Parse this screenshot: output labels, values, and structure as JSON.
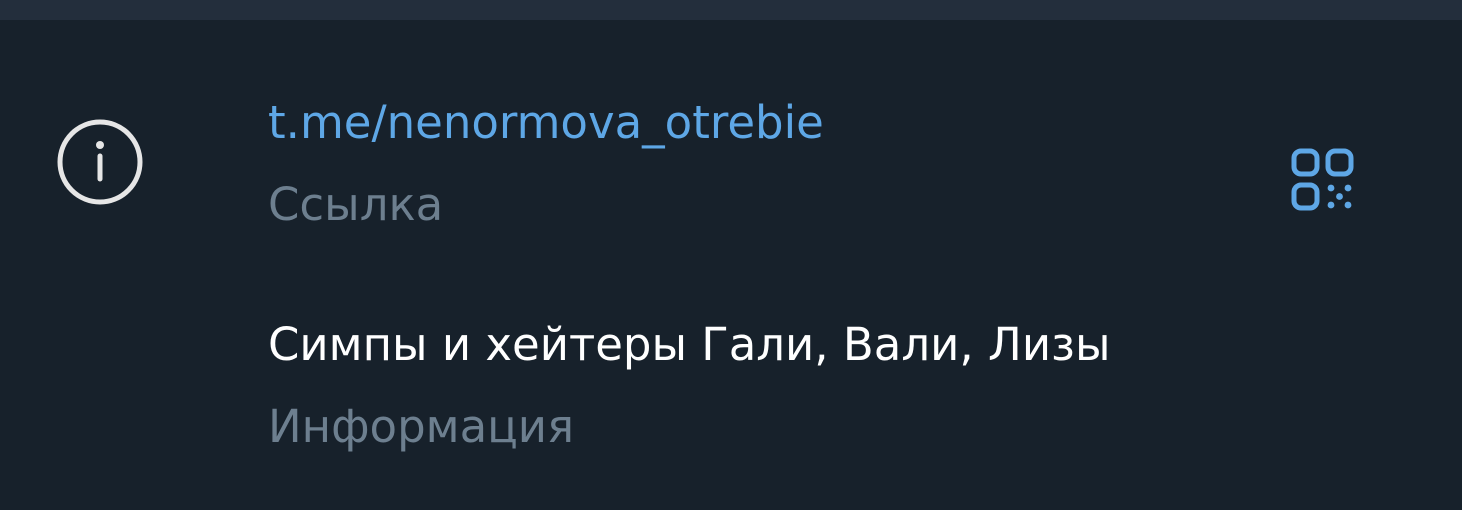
{
  "info": {
    "link": {
      "value": "t.me/nenormova_otrebie",
      "caption": "Ссылка"
    },
    "about": {
      "value": "Симпы и хейтеры Гали, Вали, Лизы",
      "caption": "Информация"
    }
  },
  "icons": {
    "info": "info-circle-icon",
    "qr": "qr-code-icon"
  },
  "colors": {
    "background": "#17212b",
    "divider": "#232e3c",
    "accent": "#5ea7e6",
    "primary_text": "#ffffff",
    "secondary_text": "#6d7f8f",
    "icon": "#e6e6e6"
  }
}
